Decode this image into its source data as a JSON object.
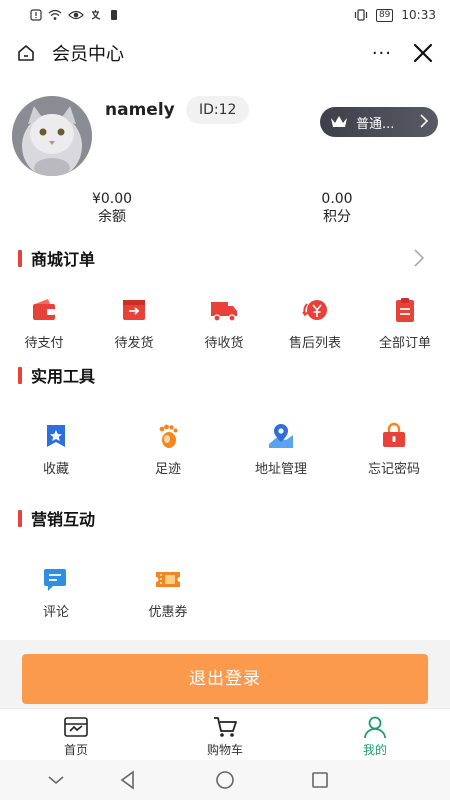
{
  "status_bar": {
    "battery": "89",
    "time": "10:33"
  },
  "header": {
    "title": "会员中心",
    "more": "···"
  },
  "profile": {
    "username": "namely",
    "user_id": "ID:12",
    "level_label": "普通..."
  },
  "stats": [
    {
      "value": "¥0.00",
      "label": "余额"
    },
    {
      "value": "0.00",
      "label": "积分"
    }
  ],
  "orders": {
    "title": "商城订单",
    "items": [
      {
        "label": "待支付",
        "icon": "wallet-icon"
      },
      {
        "label": "待发货",
        "icon": "box-arrow-icon"
      },
      {
        "label": "待收货",
        "icon": "truck-icon"
      },
      {
        "label": "售后列表",
        "icon": "refund-icon"
      },
      {
        "label": "全部订单",
        "icon": "clipboard-icon"
      }
    ]
  },
  "tools": {
    "title": "实用工具",
    "items": [
      {
        "label": "收藏",
        "icon": "bookmark-star-icon"
      },
      {
        "label": "足迹",
        "icon": "footprint-icon"
      },
      {
        "label": "地址管理",
        "icon": "map-pin-icon"
      },
      {
        "label": "忘记密码",
        "icon": "lock-icon"
      }
    ]
  },
  "marketing": {
    "title": "营销互动",
    "items": [
      {
        "label": "评论",
        "icon": "comment-icon"
      },
      {
        "label": "优惠券",
        "icon": "coupon-icon"
      }
    ]
  },
  "logout_label": "退出登录",
  "tabbar": [
    {
      "label": "首页",
      "icon": "home-store-icon",
      "active": false
    },
    {
      "label": "购物车",
      "icon": "cart-icon",
      "active": false
    },
    {
      "label": "我的",
      "icon": "person-icon",
      "active": true
    }
  ],
  "colors": {
    "accent": "#e8413a",
    "logout": "#fb9a4d",
    "tab_active": "#1f9d6c",
    "level_bg": "#3f3f4a"
  }
}
